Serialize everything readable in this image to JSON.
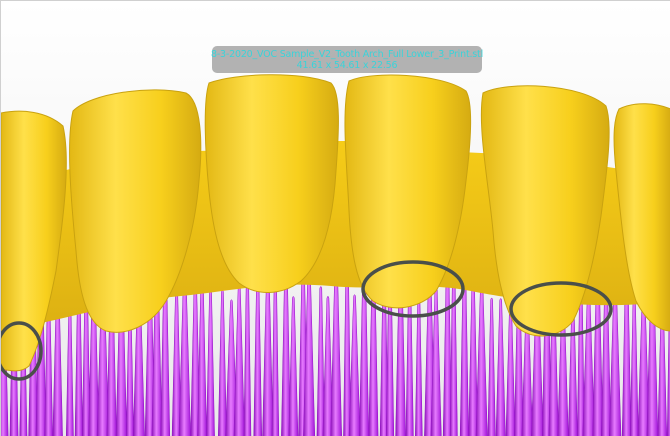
{
  "viewport": {
    "model": {
      "filename": "8-3-2020_VOC Sample_V2_Tooth Arch_Full Lower_3_Print.stl",
      "dimensions": "41.61 x 54.61 x 22.56"
    },
    "colors": {
      "tooth": "#f7cf1c",
      "tooth_shadow": "#c9a210",
      "support": "#b31ee8",
      "support_highlight": "#e77bff",
      "annotation_circle": "#4a4f4a",
      "tooltip_text": "#3ad3d9"
    },
    "annotations": [
      "marker-circle-left",
      "marker-circle-center",
      "marker-circle-right"
    ]
  }
}
